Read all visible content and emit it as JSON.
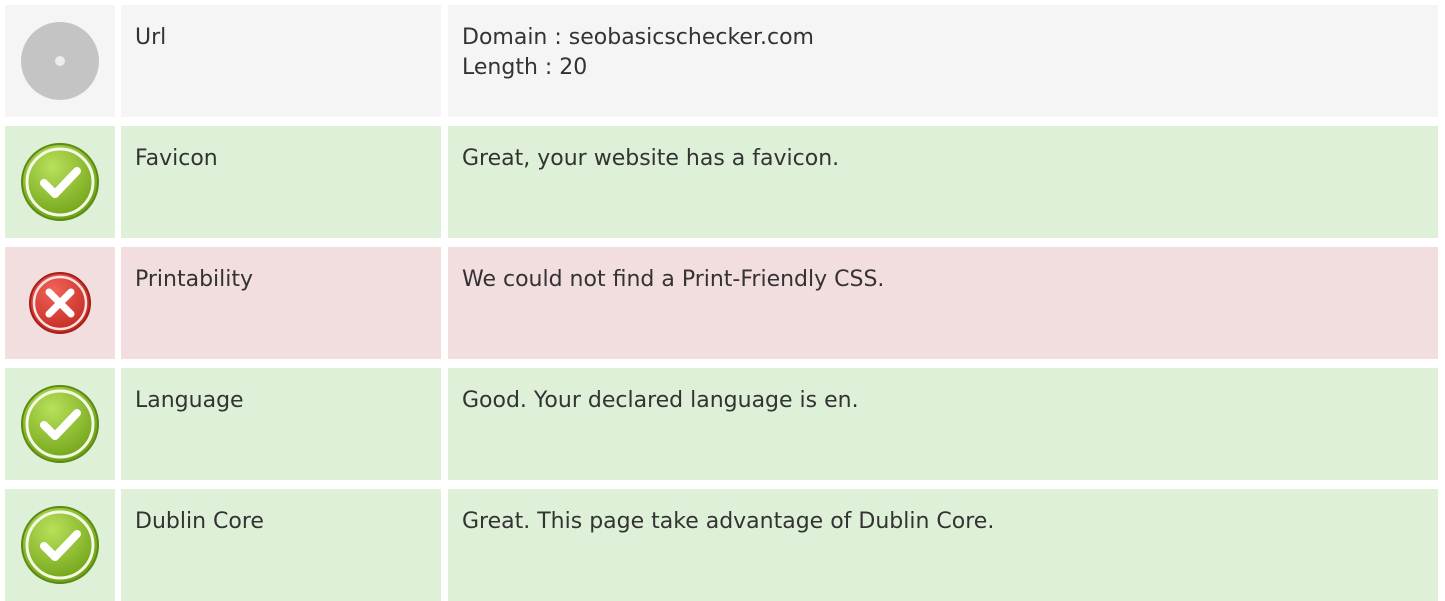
{
  "colors": {
    "neutral_bg": "#f5f5f5",
    "pass_bg": "#dff0d8",
    "fail_bg": "#f2dede",
    "text": "#333333"
  },
  "rows": [
    {
      "status": "neutral",
      "icon": "info-circle-icon",
      "name": "Url",
      "description_lines": [
        "Domain : seobasicschecker.com",
        "Length : 20"
      ]
    },
    {
      "status": "pass",
      "icon": "check-circle-icon",
      "name": "Favicon",
      "description_lines": [
        "Great, your website has a favicon."
      ]
    },
    {
      "status": "fail",
      "icon": "error-x-circle-icon",
      "name": "Printability",
      "description_lines": [
        "We could not find a Print-Friendly CSS."
      ]
    },
    {
      "status": "pass",
      "icon": "check-circle-icon",
      "name": "Language",
      "description_lines": [
        "Good. Your declared language is en."
      ]
    },
    {
      "status": "pass",
      "icon": "check-circle-icon",
      "name": "Dublin Core",
      "description_lines": [
        "Great. This page take advantage of Dublin Core."
      ]
    }
  ]
}
